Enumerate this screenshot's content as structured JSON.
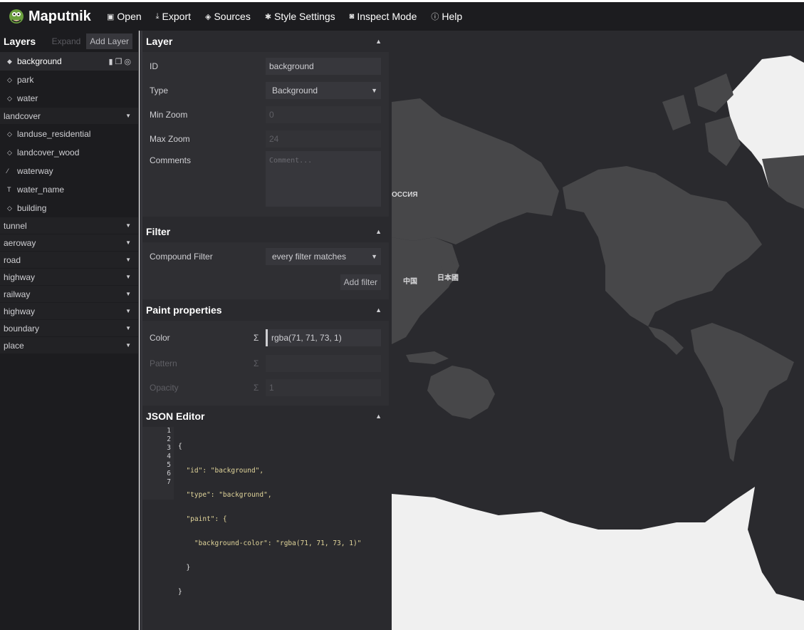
{
  "app": {
    "title": "Maputnik"
  },
  "toolbar": {
    "items": [
      {
        "label": "Open",
        "icon": "open-icon"
      },
      {
        "label": "Export",
        "icon": "download-icon"
      },
      {
        "label": "Sources",
        "icon": "layers-icon"
      },
      {
        "label": "Style Settings",
        "icon": "gear-icon"
      },
      {
        "label": "Inspect Mode",
        "icon": "inspect-icon"
      },
      {
        "label": "Help",
        "icon": "help-icon"
      }
    ]
  },
  "layers": {
    "title": "Layers",
    "expand_label": "Expand",
    "add_label": "Add Layer",
    "top_items": [
      {
        "label": "background",
        "icon": "fill-icon",
        "active": true
      },
      {
        "label": "park",
        "icon": "fill-icon"
      },
      {
        "label": "water",
        "icon": "fill-icon"
      }
    ],
    "landcover_group": "landcover",
    "landcover_items": [
      {
        "label": "landuse_residential",
        "icon": "fill-icon"
      },
      {
        "label": "landcover_wood",
        "icon": "fill-icon"
      },
      {
        "label": "waterway",
        "icon": "line-icon"
      },
      {
        "label": "water_name",
        "icon": "symbol-icon"
      },
      {
        "label": "building",
        "icon": "fill-icon"
      }
    ],
    "groups": [
      "tunnel",
      "aeroway",
      "road",
      "highway",
      "railway",
      "highway",
      "boundary",
      "place"
    ]
  },
  "layer_editor": {
    "section_title": "Layer",
    "fields": {
      "id_label": "ID",
      "id_value": "background",
      "type_label": "Type",
      "type_value": "Background",
      "minzoom_label": "Min Zoom",
      "minzoom_value": "0",
      "maxzoom_label": "Max Zoom",
      "maxzoom_value": "24",
      "comments_label": "Comments",
      "comments_placeholder": "Comment..."
    }
  },
  "filter": {
    "section_title": "Filter",
    "compound_label": "Compound Filter",
    "compound_value": "every filter matches",
    "add_filter_label": "Add filter"
  },
  "paint": {
    "section_title": "Paint properties",
    "color_label": "Color",
    "color_value": "rgba(71, 71, 73, 1)",
    "pattern_label": "Pattern",
    "pattern_value": "",
    "opacity_label": "Opacity",
    "opacity_value": "1",
    "sigma": "Σ"
  },
  "json_editor": {
    "section_title": "JSON Editor",
    "line_numbers": [
      "1",
      "2",
      "3",
      "4",
      "5",
      "6",
      "7"
    ],
    "lines": [
      "{",
      "  \"id\": \"background\",",
      "  \"type\": \"background\",",
      "  \"paint\": {",
      "    \"background-color\": \"rgba(71, 71, 73, 1)\"",
      "  }",
      "}"
    ]
  },
  "map": {
    "labels": [
      "ОССИЯ",
      "中国",
      "日本國"
    ]
  },
  "colors": {
    "panel_bg": "#1c1c1f",
    "editor_bg": "#2a2a2e",
    "input_bg": "#37373c",
    "land": "#474749",
    "ice": "#f0f0f0"
  }
}
